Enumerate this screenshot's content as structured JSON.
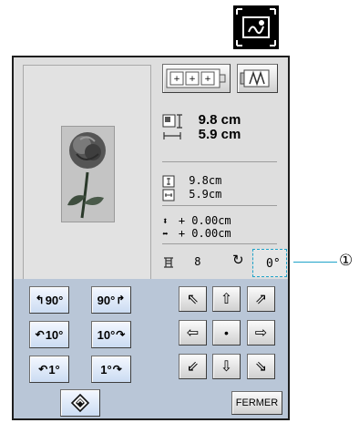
{
  "top_icon": {
    "name": "resize-icon"
  },
  "display": {
    "size_height": "9.8 cm",
    "size_width": "5.9 cm",
    "orig_height": "9.8cm",
    "orig_width": "5.9cm",
    "offset_vertical": "+ 0.00cm",
    "offset_horizontal": "+ 0.00cm",
    "thread_changes": "8",
    "rotation_angle": "0°"
  },
  "rotate": {
    "left_90": "90°",
    "right_90": "90°",
    "left_10": "10°",
    "right_10": "10°",
    "left_1": "1°",
    "right_1": "1°"
  },
  "buttons": {
    "close": "FERMER"
  },
  "callout": {
    "number": "①"
  },
  "colors": {
    "control_panel": "#b9c6d7",
    "callout_line": "#1fa3c9"
  }
}
